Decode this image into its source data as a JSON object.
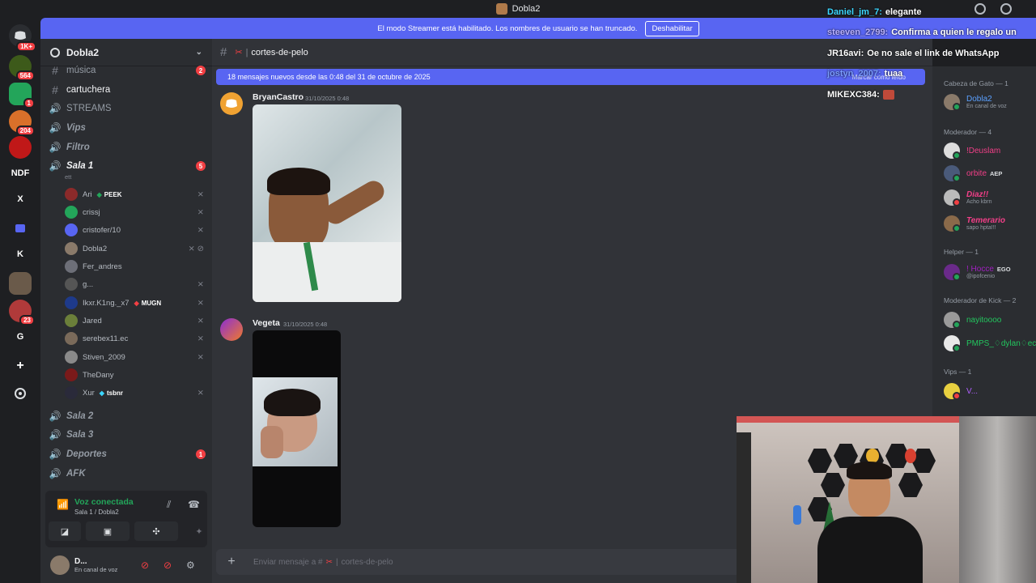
{
  "window": {
    "title": "Dobla2"
  },
  "banner": {
    "text": "El modo Streamer está habilitado. Los nombres de usuario se han truncado.",
    "button": "Deshabilitar"
  },
  "rail": {
    "badges": [
      "564",
      "1",
      "204",
      "23"
    ],
    "letters": [
      "NDF",
      "X",
      "K",
      "G"
    ]
  },
  "server": {
    "name": "Dobla2"
  },
  "channels": {
    "musica": {
      "name": "música",
      "badge": "2"
    },
    "cartuchera": {
      "name": "cartuchera"
    },
    "streams": {
      "name": "STREAMS"
    },
    "vips": {
      "name": "Vips"
    },
    "filtro": {
      "name": "Filtro"
    },
    "sala1": {
      "name": "Sala 1",
      "badge": "5",
      "sub": "ett"
    },
    "sala2": {
      "name": "Sala 2"
    },
    "sala3": {
      "name": "Sala 3"
    },
    "deportes": {
      "name": "Deportes",
      "badge": "1"
    },
    "afk": {
      "name": "AFK"
    }
  },
  "voice_users": [
    {
      "name": "Ari",
      "tag": "PEEK",
      "color": "#8b2a2a"
    },
    {
      "name": "crissj",
      "color": "#23a55a"
    },
    {
      "name": "cristofer/10",
      "color": "#5865f2"
    },
    {
      "name": "Dobla2",
      "color": "#8a7a6a"
    },
    {
      "name": "Fer_andres",
      "color": "#6d6f78"
    },
    {
      "name": "g...",
      "color": "#555"
    },
    {
      "name": "Ikxr.K1ng._x7",
      "tag": "MUGN",
      "color": "#1e3a8a"
    },
    {
      "name": "Jared",
      "color": "#6b7f3a"
    },
    {
      "name": "serebex11.ec",
      "color": "#7a6a5a"
    },
    {
      "name": "Stiven_2009",
      "color": "#8a8a8a"
    },
    {
      "name": "TheDany",
      "color": "#7a1a1a"
    },
    {
      "name": "Xur",
      "tag": "tsbnr",
      "color": "#2a2a3a"
    }
  ],
  "voice_panel": {
    "title": "Voz conectada",
    "sub": "Sala 1 / Dobla2"
  },
  "user_panel": {
    "name": "D...",
    "status": "En canal de voz"
  },
  "main": {
    "channel": "cortes-de-pelo",
    "new_messages": "18 mensajes nuevos desde las 0:48 del 31 de octubre de 2025",
    "mark_read": "Marcar como leído",
    "messages": [
      {
        "author": "BryanCastro",
        "time": "31/10/2025 0:48"
      },
      {
        "author": "Vegeta",
        "time": "31/10/2025 0:48"
      }
    ],
    "composer_placeholder": "Enviar mensaje a #",
    "composer_channel": "cortes-de-pelo"
  },
  "chat_overlay": [
    {
      "user": "Daniel_jm_7:",
      "text": "elegante",
      "color": "#3bd6ff"
    },
    {
      "user": "steeven_2799:",
      "text": "Confirma a quien le regalo un",
      "color": "#b8b0ff"
    },
    {
      "user": "JR16avi:",
      "text": "Oe no sale el link de WhatsApp",
      "color": "#ffffff"
    },
    {
      "user": "jostyn_2007:",
      "text": "tuaa",
      "color": "#7a9cff"
    },
    {
      "user": "MIKEXC384:",
      "text": "",
      "color": "#ffffff"
    }
  ],
  "members": {
    "groups": [
      "Cabeza de Gato — 1",
      "Moderador — 4",
      "Helper — 1",
      "Moderador de Kick — 2",
      "Vips — 1"
    ],
    "list": [
      {
        "name": "Dobla2",
        "status": "En canal de voz",
        "color": "#5aa0ff",
        "st": "#23a55a"
      },
      {
        "name": "!Deuslam",
        "status": "",
        "color": "#f23f88",
        "st": "#23a55a"
      },
      {
        "name": "orbite",
        "tag": "AEP",
        "status": "",
        "color": "#f23f88",
        "st": "#23a55a"
      },
      {
        "name": "Diaz!!",
        "status": "Acho kbrn",
        "color": "#f23f88",
        "st": "#f23f43"
      },
      {
        "name": "Temerario",
        "status": "sapo hpta!!!",
        "color": "#f23f88",
        "st": "#23a55a"
      },
      {
        "name": "! Hocce",
        "tag": "EGO",
        "status": "@ipofcenio",
        "color": "#a020c0",
        "st": "#23a55a"
      },
      {
        "name": "nayitoooo",
        "status": "",
        "color": "#23c55e",
        "st": "#23a55a"
      },
      {
        "name": "PMPS_♢dylan♢ec",
        "status": "",
        "color": "#23c55e",
        "st": "#23a55a"
      },
      {
        "name": "V...",
        "status": "",
        "color": "#b060ff",
        "st": "#f23f43"
      }
    ]
  }
}
